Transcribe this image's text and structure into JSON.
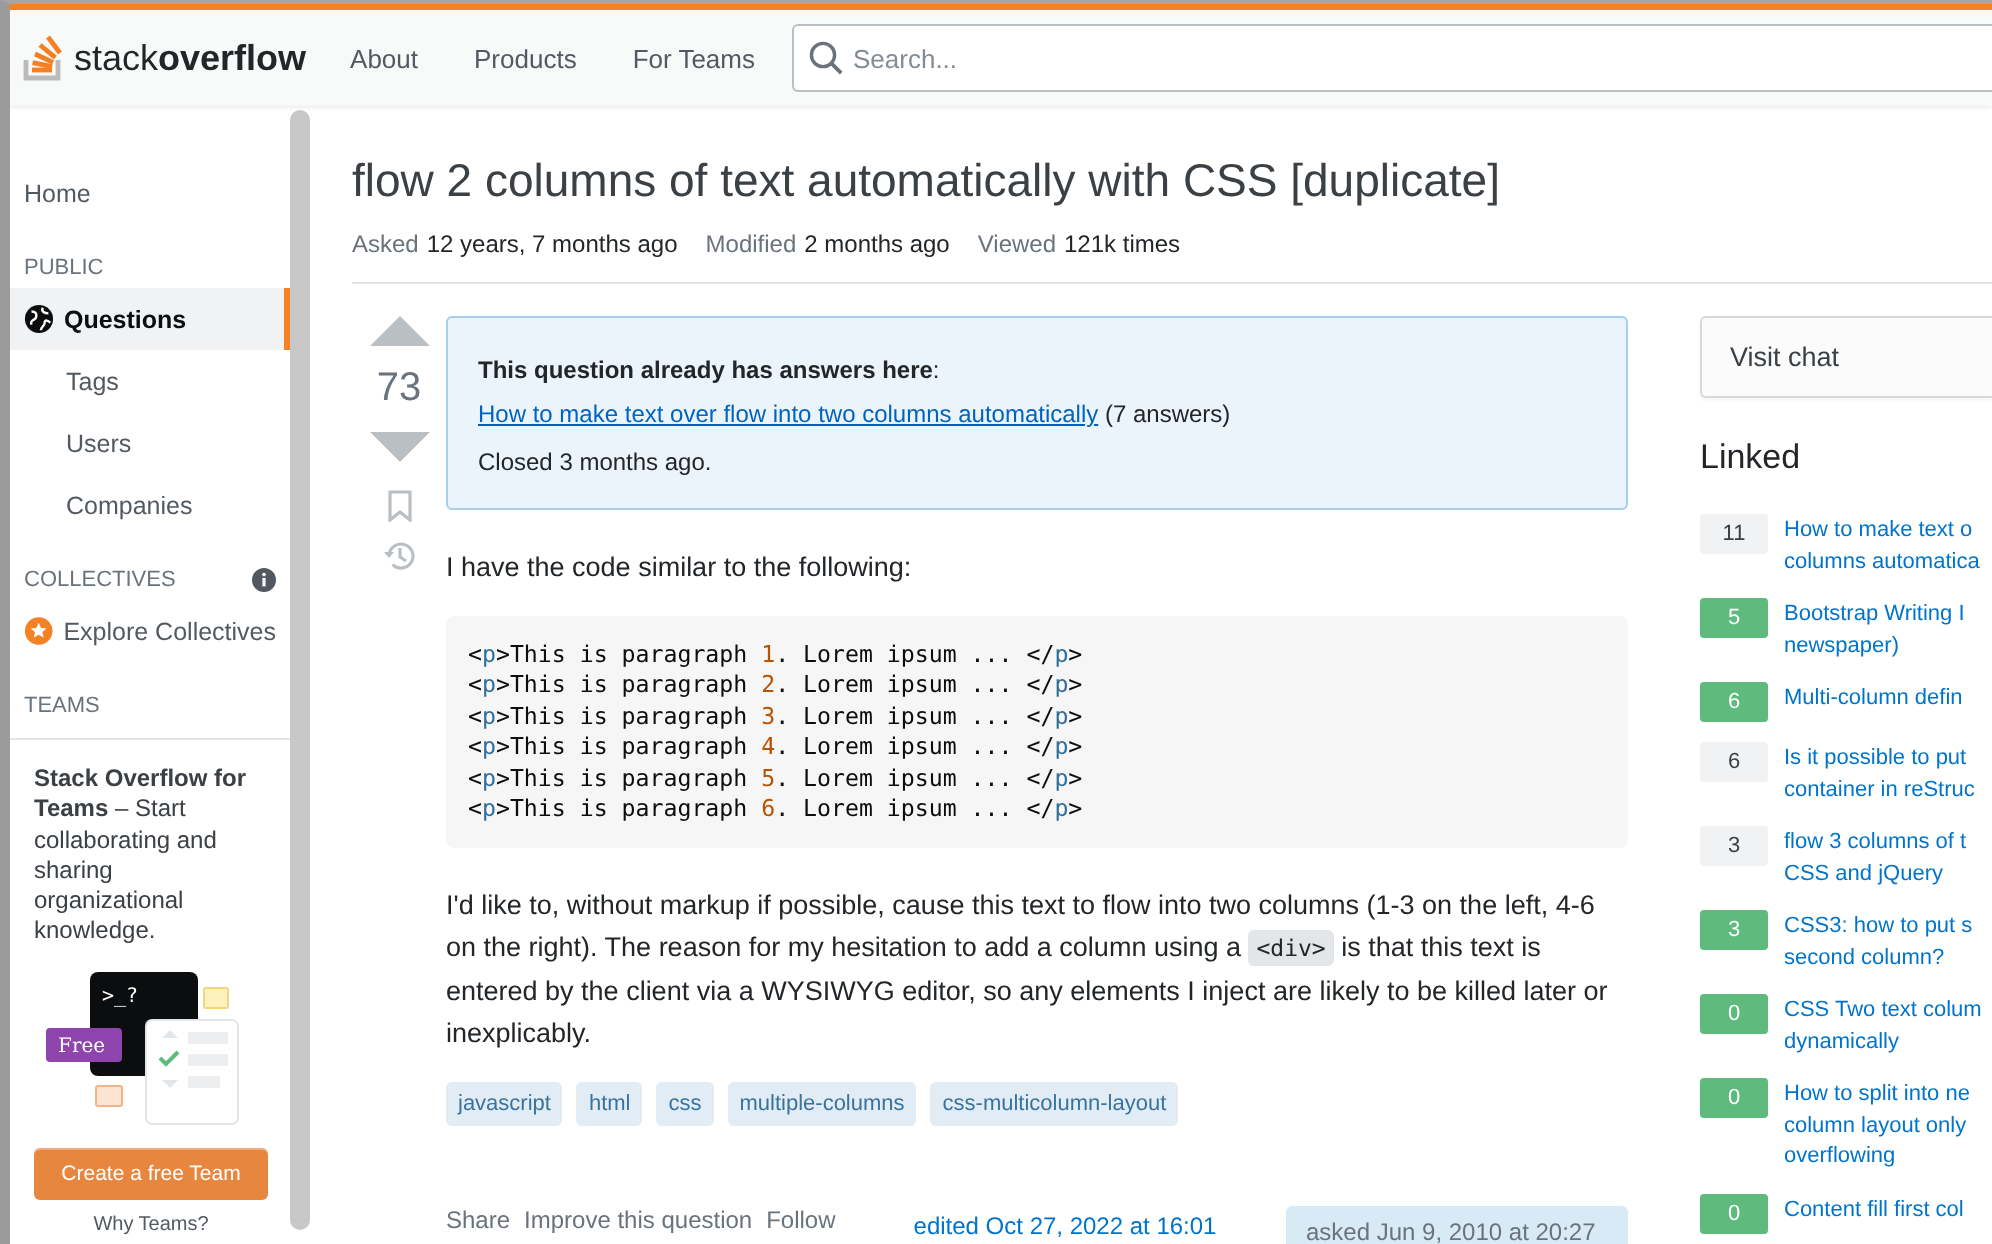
{
  "header": {
    "logo_light": "stack",
    "logo_bold": "overflow",
    "nav": [
      "About",
      "Products",
      "For Teams"
    ],
    "search": {
      "placeholder": "Search..."
    }
  },
  "sidebar": {
    "items": [
      {
        "kind": "link",
        "label": "Home",
        "selected": false
      },
      {
        "kind": "heading",
        "label": "PUBLIC"
      },
      {
        "kind": "globe",
        "label": "Questions",
        "selected": true
      },
      {
        "kind": "sublink",
        "label": "Tags",
        "selected": false
      },
      {
        "kind": "sublink",
        "label": "Users",
        "selected": false
      },
      {
        "kind": "sublink",
        "label": "Companies",
        "selected": false
      },
      {
        "kind": "heading",
        "label": "COLLECTIVES",
        "info": true
      },
      {
        "kind": "star",
        "label": "Explore Collectives",
        "selected": false
      },
      {
        "kind": "heading",
        "label": "TEAMS"
      }
    ],
    "teams": {
      "text": "**Stack Overflow for Teams** – Start collaborating and sharing organizational knowledge.",
      "prompt": ">_?",
      "badge": "Free",
      "button": "Create a free Team",
      "link": "Why Teams?"
    }
  },
  "question": {
    "title": "flow 2 columns of text automatically with CSS [duplicate]",
    "meta": [
      {
        "label": "Asked",
        "value": "12 years, 7 months ago"
      },
      {
        "label": "Modified",
        "value": "2 months ago"
      },
      {
        "label": "Viewed",
        "value": "121k times"
      }
    ],
    "votes": "73",
    "notice": {
      "heading": "**This question already has answers here**:",
      "link": "How to make text over flow into two columns automatically",
      "count": "(7 answers)",
      "closed": "Closed 3 months ago."
    },
    "intro": "I have the code similar to the following:",
    "code_lines": [
      "<p>This is paragraph 1. Lorem ipsum ... </p>",
      "<p>This is paragraph 2. Lorem ipsum ... </p>",
      "<p>This is paragraph 3. Lorem ipsum ... </p>",
      "<p>This is paragraph 4. Lorem ipsum ... </p>",
      "<p>This is paragraph 5. Lorem ipsum ... </p>",
      "<p>This is paragraph 6. Lorem ipsum ... </p>"
    ],
    "body": [
      {
        "kind": "text",
        "text": "I'd like to, without markup if possible, cause this text to flow into two columns (1-3 on the left, 4-6 on the right). The reason for my hesitation to add a column using a "
      },
      {
        "kind": "code",
        "text": "<div>"
      },
      {
        "kind": "text",
        "text": " is that this text is entered by the client via a WYSIWYG editor, so any elements I inject are likely to be killed later or inexplicably."
      }
    ],
    "tags": [
      "javascript",
      "html",
      "css",
      "multiple-columns",
      "css-multicolumn-layout"
    ],
    "actions": [
      "Share",
      "Improve this question",
      "Follow"
    ],
    "edited": "edited Oct 27, 2022 at 16:01",
    "asked": "asked Jun 9, 2010 at 20:27"
  },
  "right": {
    "chat": "Visit chat",
    "linked_title": "Linked",
    "linked": [
      {
        "score": "11",
        "accepted": false,
        "lines": [
          "How to make text o",
          "columns automatica"
        ]
      },
      {
        "score": "5",
        "accepted": true,
        "lines": [
          "Bootstrap Writing I",
          "newspaper)"
        ]
      },
      {
        "score": "6",
        "accepted": true,
        "lines": [
          "Multi-column defin"
        ]
      },
      {
        "score": "6",
        "accepted": false,
        "lines": [
          "Is it possible to put",
          "container in reStruc"
        ]
      },
      {
        "score": "3",
        "accepted": false,
        "lines": [
          "flow 3 columns of t",
          "CSS and jQuery"
        ]
      },
      {
        "score": "3",
        "accepted": true,
        "lines": [
          "CSS3: how to put s",
          "second column?"
        ]
      },
      {
        "score": "0",
        "accepted": true,
        "lines": [
          "CSS Two text colum",
          "dynamically"
        ]
      },
      {
        "score": "0",
        "accepted": true,
        "lines": [
          "How to split into ne",
          "column layout only",
          "overflowing"
        ]
      },
      {
        "score": "0",
        "accepted": true,
        "lines": [
          "Content fill first col"
        ]
      }
    ]
  }
}
